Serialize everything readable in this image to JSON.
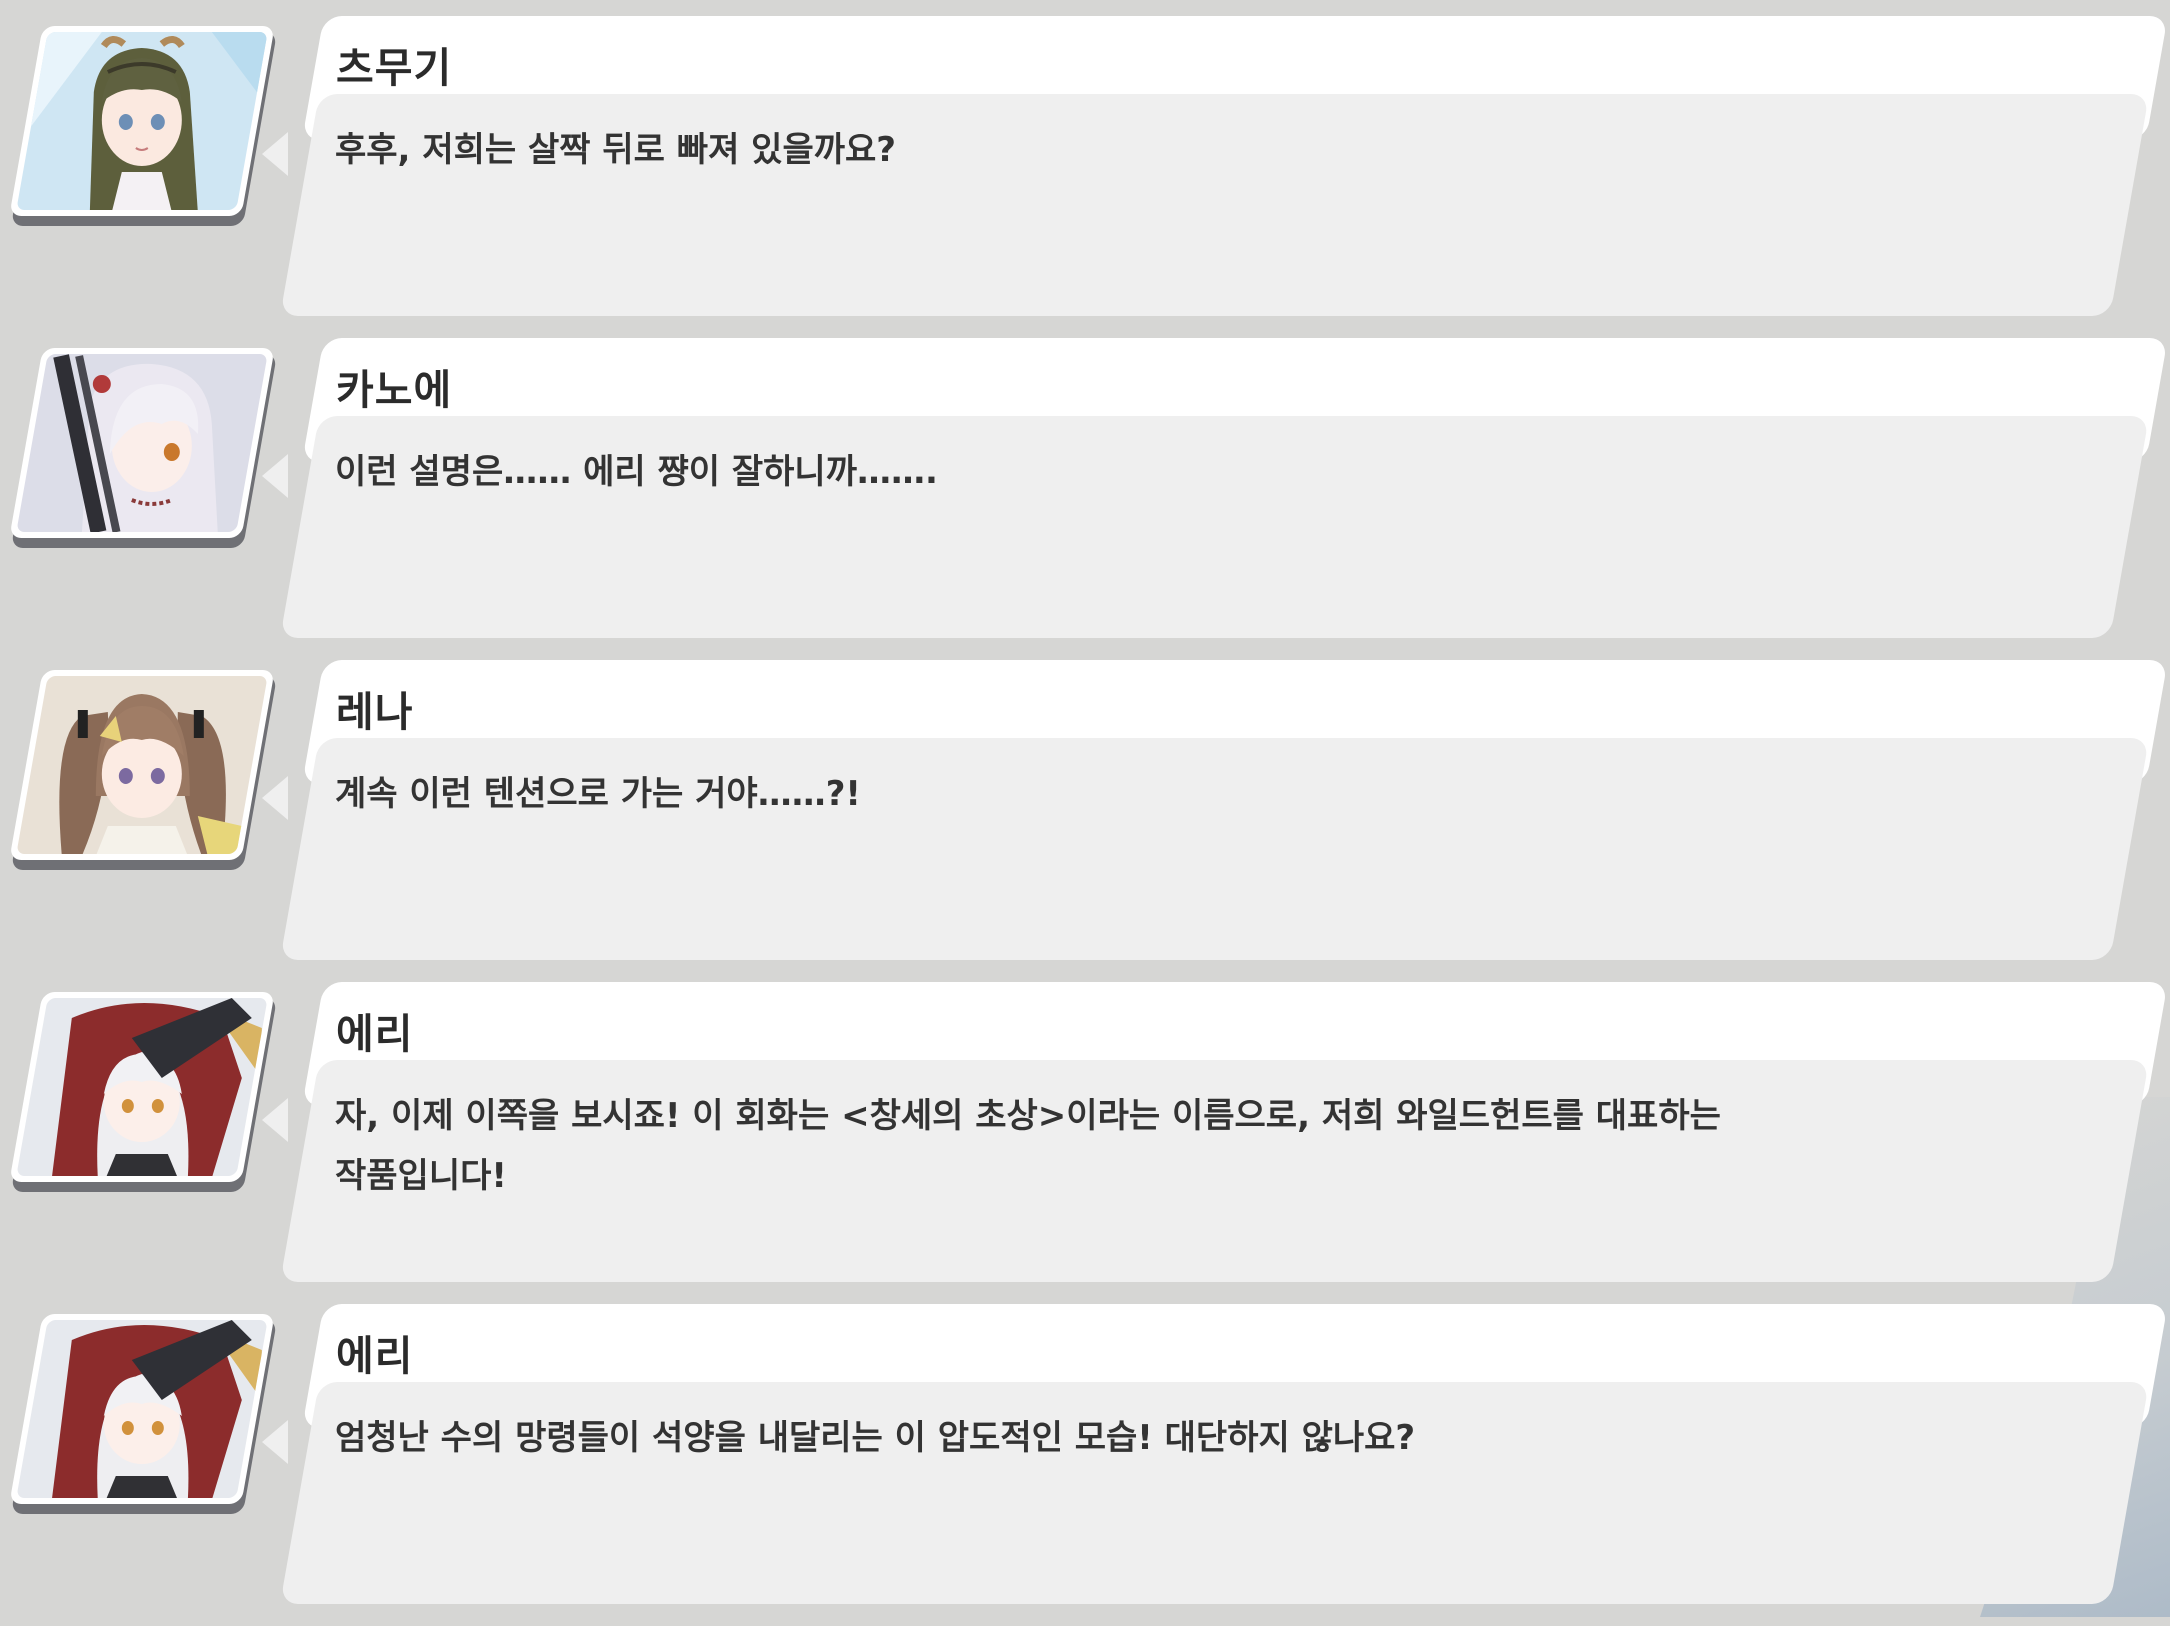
{
  "log": {
    "entries": [
      {
        "speaker": "츠무기",
        "avatar_icon": "tsumugi-portrait-icon",
        "text": "후후, 저희는 살짝 뒤로 빠져 있을까요?"
      },
      {
        "speaker": "카노에",
        "avatar_icon": "kanoe-portrait-icon",
        "text": "이런 설명은…… 에리 쨩이 잘하니까…….",
        "colors": {
          "hair": "#e6e3ee",
          "eye": "#c9782c"
        }
      },
      {
        "speaker": "레나",
        "avatar_icon": "rena-portrait-icon",
        "text": "계속 이런 텐션으로 가는 거야……?!"
      },
      {
        "speaker": "에리",
        "avatar_icon": "eri-portrait-icon",
        "text": "자, 이제 이쪽을 보시죠! 이 회화는 <창세의 초상>이라는 이름으로, 저희 와일드헌트를 대표하는\n작품입니다!"
      },
      {
        "speaker": "에리",
        "avatar_icon": "eri-portrait-icon",
        "text": "엄청난 수의 망령들이 석양을 내달리는 이 압도적인 모습! 대단하지 않나요?"
      }
    ]
  },
  "colors": {
    "background": "#d6d6d4",
    "name_plate": "#ffffff",
    "dialog_box": "#efefef",
    "speaker_text": "#2b2b2b",
    "line_text": "#333333"
  }
}
